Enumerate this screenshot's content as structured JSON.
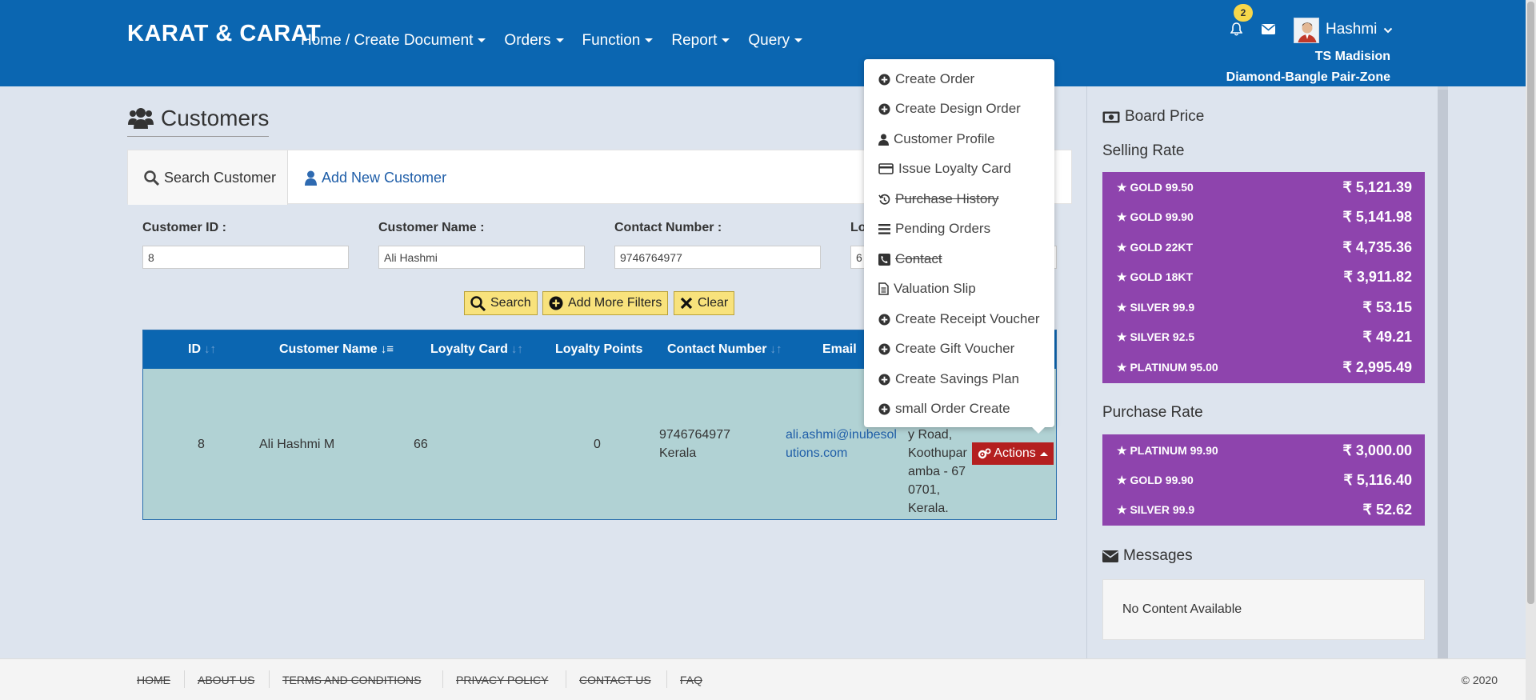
{
  "header": {
    "brand": "KARAT & CARAT",
    "nav": [
      "Home / Create Document",
      "Orders",
      "Function",
      "Report",
      "Query"
    ],
    "notifications": "2",
    "user": "Hashmi",
    "store": "TS Madision",
    "zone": "Diamond-Bangle Pair-Zone"
  },
  "page": {
    "title": "Customers"
  },
  "tabs": {
    "search": "Search Customer",
    "add": "Add New Customer"
  },
  "form": {
    "customer_id": {
      "label": "Customer ID :",
      "value": "8"
    },
    "customer_name": {
      "label": "Customer Name :",
      "value": "Ali Hashmi"
    },
    "contact_number": {
      "label": "Contact Number :",
      "value": "9746764977"
    },
    "loyalty_card": {
      "label": "Lo",
      "value": "6"
    }
  },
  "buttons": {
    "search": "Search",
    "add_filters": "Add More Filters",
    "clear": "Clear"
  },
  "table": {
    "headers": [
      "ID",
      "Customer Name",
      "Loyalty Card",
      "Loyalty Points",
      "Contact Number",
      "Email"
    ],
    "row": {
      "id": "8",
      "name": "Ali Hashmi M",
      "loyalty_card": "66",
      "loyalty_points": "0",
      "contact_1": "9746764977",
      "contact_2": "Kerala",
      "email_1": "ali.ashmi@inubesol",
      "email_2": "utions.com",
      "address_1": "y Road,",
      "address_2": "Koothupar",
      "address_3": "amba - 67",
      "address_4": "0701,",
      "address_5": "Kerala.",
      "actions": "Actions"
    }
  },
  "actions_menu": [
    {
      "label": "Create Order",
      "icon": "plus-circle-icon",
      "disabled": false
    },
    {
      "label": "Create Design Order",
      "icon": "plus-circle-icon",
      "disabled": false
    },
    {
      "label": "Customer Profile",
      "icon": "user-icon",
      "disabled": false
    },
    {
      "label": "Issue Loyalty Card",
      "icon": "credit-card-icon",
      "disabled": false
    },
    {
      "label": "Purchase History",
      "icon": "history-icon",
      "disabled": true
    },
    {
      "label": "Pending Orders",
      "icon": "list-icon",
      "disabled": false
    },
    {
      "label": "Contact",
      "icon": "phone-icon",
      "disabled": true
    },
    {
      "label": "Valuation Slip",
      "icon": "document-icon",
      "disabled": false
    },
    {
      "label": "Create Receipt Voucher",
      "icon": "plus-circle-icon",
      "disabled": false
    },
    {
      "label": "Create Gift Voucher",
      "icon": "plus-circle-icon",
      "disabled": false
    },
    {
      "label": "Create Savings Plan",
      "icon": "plus-circle-icon",
      "disabled": false
    },
    {
      "label": "small Order Create",
      "icon": "plus-circle-icon",
      "disabled": false
    }
  ],
  "sidebar": {
    "board_price": "Board Price",
    "selling_rate": "Selling Rate",
    "selling": [
      {
        "name": "GOLD 99.50",
        "value": "₹ 5,121.39"
      },
      {
        "name": "GOLD 99.90",
        "value": "₹ 5,141.98"
      },
      {
        "name": "GOLD 22KT",
        "value": "₹ 4,735.36"
      },
      {
        "name": "GOLD 18KT",
        "value": "₹ 3,911.82"
      },
      {
        "name": "SILVER 99.9",
        "value": "₹ 53.15"
      },
      {
        "name": "SILVER 92.5",
        "value": "₹ 49.21"
      },
      {
        "name": "PLATINUM 95.00",
        "value": "₹ 2,995.49"
      }
    ],
    "purchase_rate": "Purchase Rate",
    "purchase": [
      {
        "name": "PLATINUM 99.90",
        "value": "₹ 3,000.00"
      },
      {
        "name": "GOLD 99.90",
        "value": "₹ 5,116.40"
      },
      {
        "name": "SILVER 99.9",
        "value": "₹ 52.62"
      }
    ],
    "messages": "Messages",
    "no_content": "No Content Available"
  },
  "footer": {
    "links": [
      "HOME",
      "ABOUT US",
      "TERMS AND CONDITIONS",
      "PRIVACY POLICY",
      "CONTACT US",
      "FAQ"
    ],
    "copyright": "© 2020"
  },
  "colors": {
    "navbar": "#0b66b1",
    "rate_box": "#8e44ad",
    "row_bg": "#b1d2d4",
    "actions_btn": "#b41f1f",
    "button_yellow": "#f8e27c"
  }
}
